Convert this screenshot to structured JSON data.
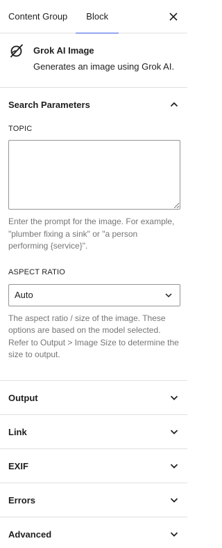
{
  "tabs": [
    {
      "label": "Content Group",
      "active": false
    },
    {
      "label": "Block",
      "active": true
    }
  ],
  "close_icon": "close-icon",
  "block": {
    "icon": "grok-logo-icon",
    "title": "Grok AI Image",
    "description": "Generates an image using Grok AI."
  },
  "search_parameters": {
    "title": "Search Parameters",
    "expanded": true,
    "topic": {
      "label": "TOPIC",
      "value": "",
      "help": "Enter the prompt for the image. For example, \"plumber fixing a sink\" or \"a person performing {service}\"."
    },
    "aspect_ratio": {
      "label": "ASPECT RATIO",
      "selected": "Auto",
      "help": "The aspect ratio / size of the image. These options are based on the model selected. Refer to Output > Image Size to determine the size to output."
    }
  },
  "panels": [
    {
      "title": "Output"
    },
    {
      "title": "Link"
    },
    {
      "title": "EXIF"
    },
    {
      "title": "Errors"
    },
    {
      "title": "Advanced"
    }
  ],
  "colors": {
    "accent": "#3858e9",
    "border": "#e0e0e0",
    "help_text": "#757575"
  }
}
